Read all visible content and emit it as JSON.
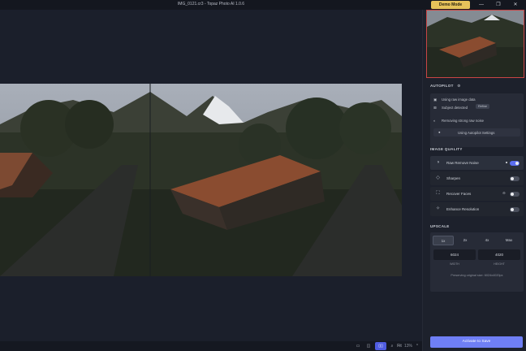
{
  "window": {
    "title": "IMG_0121.cr3 - Topaz Photo AI 1.0.6",
    "demo_label": "Demo Mode",
    "minimize": "—",
    "maximize": "❐",
    "close": "✕"
  },
  "autopilot": {
    "heading": "AUTOPILOT",
    "raw_data": "Using raw image data",
    "subject_text": "Subject detected",
    "subject_badge": "Refine",
    "removing": "Removing strong raw noise",
    "settings_button": "Using Autopilot Settings"
  },
  "image_quality": {
    "heading": "IMAGE QUALITY",
    "items": [
      {
        "label": "Raw Remove Noise",
        "enabled": true
      },
      {
        "label": "Sharpen",
        "enabled": false
      },
      {
        "label": "Recover Faces",
        "enabled": false
      },
      {
        "label": "Enhance Resolution",
        "enabled": false
      }
    ]
  },
  "upscale": {
    "heading": "UPSCALE",
    "options": [
      "1x",
      "2x",
      "4x",
      "Max"
    ],
    "selected": "1x",
    "width_value": "6024",
    "height_value": "4020",
    "width_label": "WIDTH",
    "height_label": "HEIGHT",
    "note": "Preserving original size: 6024x4020px"
  },
  "save_button": "Activate to Save",
  "bottom_toolbar": {
    "zoom_label": "Fit",
    "zoom_value": "13%"
  },
  "colors": {
    "accent": "#5b6ef2",
    "demo": "#e6c25a",
    "thumb_border": "#c94545"
  },
  "icons": [
    "camera-icon",
    "subject-icon",
    "noise-icon",
    "gear-icon",
    "sharpen-icon",
    "face-icon",
    "resolution-icon",
    "lock-icon"
  ]
}
